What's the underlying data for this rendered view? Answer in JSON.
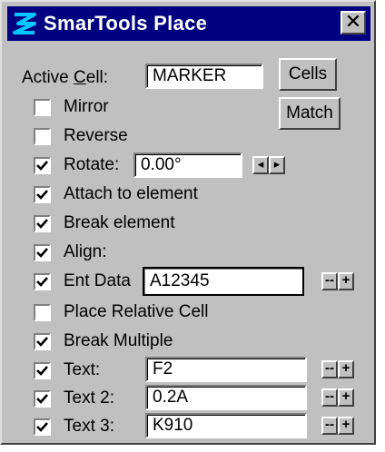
{
  "window": {
    "title": "SmarTools Place",
    "close_glyph": "✕",
    "icon": "smartools-s-icon"
  },
  "active_cell": {
    "label_pre": "Active ",
    "label_ul": "C",
    "label_post": "ell:",
    "value": "MARKER"
  },
  "buttons": {
    "cells": "Cells",
    "match": "Match"
  },
  "options": {
    "mirror": {
      "label": "Mirror",
      "checked": false
    },
    "reverse": {
      "label": "Reverse",
      "checked": false
    },
    "rotate": {
      "label": "Rotate:",
      "checked": true,
      "value": "0.00°"
    },
    "attach": {
      "label": "Attach to element",
      "checked": true
    },
    "break_element": {
      "label": "Break element",
      "checked": true
    },
    "align": {
      "label": "Align:",
      "checked": true
    },
    "ent_data": {
      "label": "Ent Data",
      "checked": true,
      "value": "A12345"
    },
    "place_relative": {
      "label": "Place Relative Cell",
      "checked": false
    },
    "break_multiple": {
      "label": "Break Multiple",
      "checked": true
    },
    "text1": {
      "label": "Text:",
      "checked": true,
      "value": "F2"
    },
    "text2": {
      "label": "Text 2:",
      "checked": true,
      "value": "0.2A"
    },
    "text3": {
      "label": "Text 3:",
      "checked": true,
      "value": "K910"
    }
  },
  "stepper": {
    "minus": "--",
    "plus": "+"
  },
  "spin": {
    "left": "◂",
    "right": "▸"
  },
  "colors": {
    "titlebar": "#000080",
    "face": "#c0c0c0",
    "icon": "#00c8ff"
  }
}
